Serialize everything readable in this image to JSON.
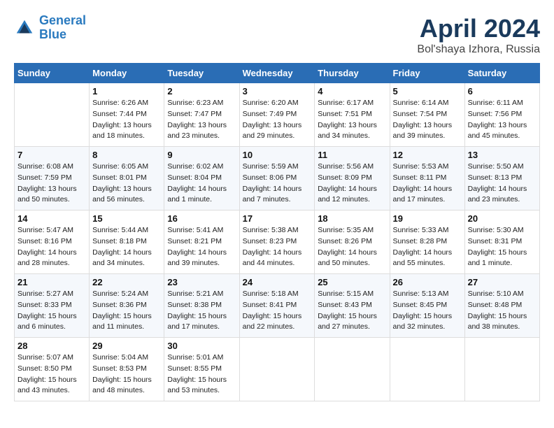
{
  "logo": {
    "name1": "General",
    "name2": "Blue"
  },
  "title": {
    "month": "April 2024",
    "location": "Bol'shaya Izhora, Russia"
  },
  "headers": [
    "Sunday",
    "Monday",
    "Tuesday",
    "Wednesday",
    "Thursday",
    "Friday",
    "Saturday"
  ],
  "weeks": [
    [
      {
        "day": "",
        "sunrise": "",
        "sunset": "",
        "daylight": ""
      },
      {
        "day": "1",
        "sunrise": "Sunrise: 6:26 AM",
        "sunset": "Sunset: 7:44 PM",
        "daylight": "Daylight: 13 hours and 18 minutes."
      },
      {
        "day": "2",
        "sunrise": "Sunrise: 6:23 AM",
        "sunset": "Sunset: 7:47 PM",
        "daylight": "Daylight: 13 hours and 23 minutes."
      },
      {
        "day": "3",
        "sunrise": "Sunrise: 6:20 AM",
        "sunset": "Sunset: 7:49 PM",
        "daylight": "Daylight: 13 hours and 29 minutes."
      },
      {
        "day": "4",
        "sunrise": "Sunrise: 6:17 AM",
        "sunset": "Sunset: 7:51 PM",
        "daylight": "Daylight: 13 hours and 34 minutes."
      },
      {
        "day": "5",
        "sunrise": "Sunrise: 6:14 AM",
        "sunset": "Sunset: 7:54 PM",
        "daylight": "Daylight: 13 hours and 39 minutes."
      },
      {
        "day": "6",
        "sunrise": "Sunrise: 6:11 AM",
        "sunset": "Sunset: 7:56 PM",
        "daylight": "Daylight: 13 hours and 45 minutes."
      }
    ],
    [
      {
        "day": "7",
        "sunrise": "Sunrise: 6:08 AM",
        "sunset": "Sunset: 7:59 PM",
        "daylight": "Daylight: 13 hours and 50 minutes."
      },
      {
        "day": "8",
        "sunrise": "Sunrise: 6:05 AM",
        "sunset": "Sunset: 8:01 PM",
        "daylight": "Daylight: 13 hours and 56 minutes."
      },
      {
        "day": "9",
        "sunrise": "Sunrise: 6:02 AM",
        "sunset": "Sunset: 8:04 PM",
        "daylight": "Daylight: 14 hours and 1 minute."
      },
      {
        "day": "10",
        "sunrise": "Sunrise: 5:59 AM",
        "sunset": "Sunset: 8:06 PM",
        "daylight": "Daylight: 14 hours and 7 minutes."
      },
      {
        "day": "11",
        "sunrise": "Sunrise: 5:56 AM",
        "sunset": "Sunset: 8:09 PM",
        "daylight": "Daylight: 14 hours and 12 minutes."
      },
      {
        "day": "12",
        "sunrise": "Sunrise: 5:53 AM",
        "sunset": "Sunset: 8:11 PM",
        "daylight": "Daylight: 14 hours and 17 minutes."
      },
      {
        "day": "13",
        "sunrise": "Sunrise: 5:50 AM",
        "sunset": "Sunset: 8:13 PM",
        "daylight": "Daylight: 14 hours and 23 minutes."
      }
    ],
    [
      {
        "day": "14",
        "sunrise": "Sunrise: 5:47 AM",
        "sunset": "Sunset: 8:16 PM",
        "daylight": "Daylight: 14 hours and 28 minutes."
      },
      {
        "day": "15",
        "sunrise": "Sunrise: 5:44 AM",
        "sunset": "Sunset: 8:18 PM",
        "daylight": "Daylight: 14 hours and 34 minutes."
      },
      {
        "day": "16",
        "sunrise": "Sunrise: 5:41 AM",
        "sunset": "Sunset: 8:21 PM",
        "daylight": "Daylight: 14 hours and 39 minutes."
      },
      {
        "day": "17",
        "sunrise": "Sunrise: 5:38 AM",
        "sunset": "Sunset: 8:23 PM",
        "daylight": "Daylight: 14 hours and 44 minutes."
      },
      {
        "day": "18",
        "sunrise": "Sunrise: 5:35 AM",
        "sunset": "Sunset: 8:26 PM",
        "daylight": "Daylight: 14 hours and 50 minutes."
      },
      {
        "day": "19",
        "sunrise": "Sunrise: 5:33 AM",
        "sunset": "Sunset: 8:28 PM",
        "daylight": "Daylight: 14 hours and 55 minutes."
      },
      {
        "day": "20",
        "sunrise": "Sunrise: 5:30 AM",
        "sunset": "Sunset: 8:31 PM",
        "daylight": "Daylight: 15 hours and 1 minute."
      }
    ],
    [
      {
        "day": "21",
        "sunrise": "Sunrise: 5:27 AM",
        "sunset": "Sunset: 8:33 PM",
        "daylight": "Daylight: 15 hours and 6 minutes."
      },
      {
        "day": "22",
        "sunrise": "Sunrise: 5:24 AM",
        "sunset": "Sunset: 8:36 PM",
        "daylight": "Daylight: 15 hours and 11 minutes."
      },
      {
        "day": "23",
        "sunrise": "Sunrise: 5:21 AM",
        "sunset": "Sunset: 8:38 PM",
        "daylight": "Daylight: 15 hours and 17 minutes."
      },
      {
        "day": "24",
        "sunrise": "Sunrise: 5:18 AM",
        "sunset": "Sunset: 8:41 PM",
        "daylight": "Daylight: 15 hours and 22 minutes."
      },
      {
        "day": "25",
        "sunrise": "Sunrise: 5:15 AM",
        "sunset": "Sunset: 8:43 PM",
        "daylight": "Daylight: 15 hours and 27 minutes."
      },
      {
        "day": "26",
        "sunrise": "Sunrise: 5:13 AM",
        "sunset": "Sunset: 8:45 PM",
        "daylight": "Daylight: 15 hours and 32 minutes."
      },
      {
        "day": "27",
        "sunrise": "Sunrise: 5:10 AM",
        "sunset": "Sunset: 8:48 PM",
        "daylight": "Daylight: 15 hours and 38 minutes."
      }
    ],
    [
      {
        "day": "28",
        "sunrise": "Sunrise: 5:07 AM",
        "sunset": "Sunset: 8:50 PM",
        "daylight": "Daylight: 15 hours and 43 minutes."
      },
      {
        "day": "29",
        "sunrise": "Sunrise: 5:04 AM",
        "sunset": "Sunset: 8:53 PM",
        "daylight": "Daylight: 15 hours and 48 minutes."
      },
      {
        "day": "30",
        "sunrise": "Sunrise: 5:01 AM",
        "sunset": "Sunset: 8:55 PM",
        "daylight": "Daylight: 15 hours and 53 minutes."
      },
      {
        "day": "",
        "sunrise": "",
        "sunset": "",
        "daylight": ""
      },
      {
        "day": "",
        "sunrise": "",
        "sunset": "",
        "daylight": ""
      },
      {
        "day": "",
        "sunrise": "",
        "sunset": "",
        "daylight": ""
      },
      {
        "day": "",
        "sunrise": "",
        "sunset": "",
        "daylight": ""
      }
    ]
  ]
}
